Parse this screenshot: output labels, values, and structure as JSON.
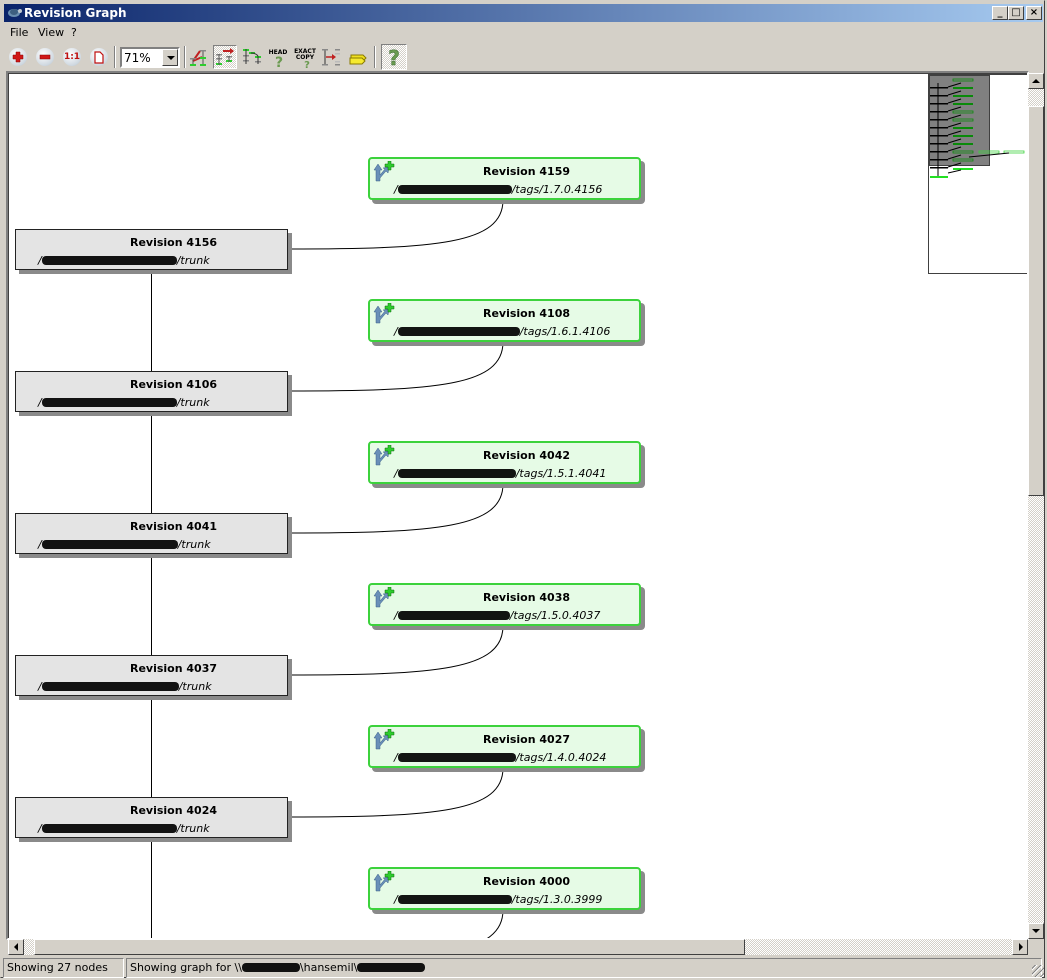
{
  "window": {
    "title": "Revision Graph",
    "controls": {
      "minimize": "_",
      "maximize": "□",
      "close": "×"
    }
  },
  "menu": {
    "items": [
      {
        "label": "File",
        "accel": "F"
      },
      {
        "label": "View",
        "accel": "V"
      },
      {
        "label": "?",
        "accel": "?"
      }
    ]
  },
  "toolbar": {
    "buttons": [
      {
        "name": "zoom-in",
        "icon": "plus-icon"
      },
      {
        "name": "zoom-out",
        "icon": "minus-icon"
      },
      {
        "name": "zoom-100",
        "icon": "one-to-one-icon",
        "text": "1:1"
      },
      {
        "name": "zoom-fit",
        "icon": "page-icon"
      },
      {
        "name": "group-branches",
        "icon": "branch-tree-icon"
      },
      {
        "name": "oldest-on-top",
        "icon": "order-arrow-icon",
        "pressed": true
      },
      {
        "name": "align-trees",
        "icon": "align-tree-icon"
      },
      {
        "name": "show-head",
        "icon": "head-icon",
        "text": "HEAD"
      },
      {
        "name": "exact-copy",
        "icon": "exact-copy-icon",
        "text": "EXACT COPY"
      },
      {
        "name": "fold-tags",
        "icon": "fold-tags-icon"
      },
      {
        "name": "show-tags",
        "icon": "tag-icon"
      },
      {
        "name": "show-legend",
        "icon": "question-icon",
        "pressed": true
      }
    ],
    "zoom": {
      "value": "71%"
    }
  },
  "graph": {
    "colors": {
      "trunk_fill": "#e4e4e4",
      "tag_fill": "#e6fbe6",
      "tag_border": "#3cd23c",
      "shadow": "#8a8a8a"
    },
    "trunk_nodes": [
      {
        "revision": "Revision 4156",
        "path_suffix": "/trunk"
      },
      {
        "revision": "Revision 4106",
        "path_suffix": "/trunk"
      },
      {
        "revision": "Revision 4041",
        "path_suffix": "/trunk"
      },
      {
        "revision": "Revision 4037",
        "path_suffix": "/trunk"
      },
      {
        "revision": "Revision 4024",
        "path_suffix": "/trunk"
      }
    ],
    "tag_nodes": [
      {
        "revision": "Revision 4159",
        "path_suffix": "/tags/1.7.0.4156"
      },
      {
        "revision": "Revision 4108",
        "path_suffix": "/tags/1.6.1.4106"
      },
      {
        "revision": "Revision 4042",
        "path_suffix": "/tags/1.5.1.4041"
      },
      {
        "revision": "Revision 4038",
        "path_suffix": "/tags/1.5.0.4037"
      },
      {
        "revision": "Revision 4027",
        "path_suffix": "/tags/1.4.0.4024"
      },
      {
        "revision": "Revision 4000",
        "path_suffix": "/tags/1.3.0.3999"
      }
    ],
    "path_prefix": "/"
  },
  "scroll": {
    "vertical_position": 0.02,
    "vertical_visible": 0.45,
    "horizontal_position": 0.01,
    "horizontal_visible": 0.72
  },
  "status": {
    "nodes": "Showing 27 nodes",
    "graph_for_prefix": "Showing graph for \\\\",
    "graph_for_middle": "\\hansemil\\"
  }
}
